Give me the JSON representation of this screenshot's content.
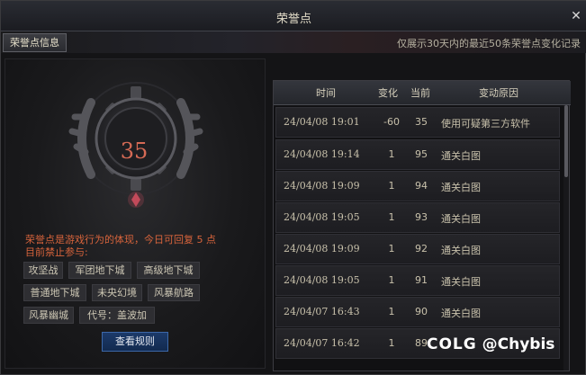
{
  "window": {
    "title": "荣誉点"
  },
  "tabs": {
    "active": "荣誉点信息"
  },
  "top_note": "仅展示30天内的最近50条荣誉点变化记录",
  "emblem": {
    "score": "35"
  },
  "info": {
    "line1": "荣誉点是游戏行为的体现，今日可回复 5 点",
    "line2": "目前禁止参与:"
  },
  "banned": [
    "攻坚战",
    "军团地下城",
    "高级地下城",
    "普通地下城",
    "未央幻境",
    "风暴航路",
    "风暴幽城",
    "代号：盖波加"
  ],
  "rules_button": "查看规则",
  "table": {
    "headers": [
      "时间",
      "变化",
      "当前",
      "变动原因"
    ],
    "rows": [
      {
        "time": "24/04/08 19:01",
        "change": "-60",
        "current": "35",
        "reason": "使用可疑第三方软件"
      },
      {
        "time": "24/04/08 19:14",
        "change": "1",
        "current": "95",
        "reason": "通关白图"
      },
      {
        "time": "24/04/08 19:09",
        "change": "1",
        "current": "94",
        "reason": "通关白图"
      },
      {
        "time": "24/04/08 19:05",
        "change": "1",
        "current": "93",
        "reason": "通关白图"
      },
      {
        "time": "24/04/08 19:09",
        "change": "1",
        "current": "92",
        "reason": "通关白图"
      },
      {
        "time": "24/04/08 19:05",
        "change": "1",
        "current": "91",
        "reason": "通关白图"
      },
      {
        "time": "24/04/07 16:43",
        "change": "1",
        "current": "90",
        "reason": "通关白图"
      },
      {
        "time": "24/04/07 16:42",
        "change": "1",
        "current": "89",
        "reason": ""
      }
    ]
  },
  "watermark": {
    "logo": "COLG",
    "handle": "@Chybis"
  }
}
